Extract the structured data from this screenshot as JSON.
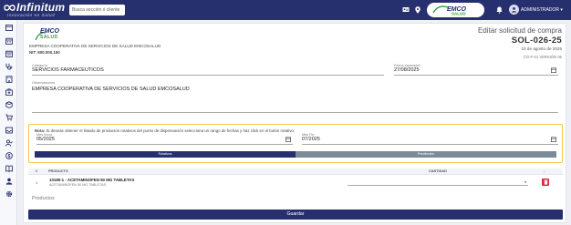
{
  "header": {
    "logo_text": "Infinitum",
    "logo_sub": "Innovación en Salud",
    "search_placeholder": "Busca sección ó cliente",
    "user_label": "ADMINISTRADOR",
    "icons": [
      "id-card-icon",
      "location-pin-icon",
      "bell-icon",
      "user-avatar-icon",
      "chevron-down-icon"
    ]
  },
  "sidebar": {
    "icons": [
      "menu-icon",
      "calendar-icon",
      "calendar-alt-icon",
      "stethoscope-icon",
      "building-icon",
      "medkit-icon",
      "box-icon",
      "cart-icon",
      "inbox-icon",
      "user-check-icon",
      "dollar-icon",
      "book-icon",
      "user-icon",
      "gear-icon"
    ]
  },
  "company": {
    "logo_emco": "EMCO",
    "logo_salud": "SALUD",
    "name": "EMPRESA COOPERATIVA DE SERVICIOS DE SALUD EMCOSALUD",
    "nit": "NIT: 800.000.150"
  },
  "document": {
    "title": "Editar solicitud de compra",
    "code": "SOL-026-25",
    "date": "22 de agosto de 2025",
    "version": "CO-F-01 VERSIÓN 06"
  },
  "form": {
    "categoria_label": "Categoría",
    "categoria_value": "SERVICIOS FARMACEUTICOS",
    "fecha_label": "Fecha esperada*",
    "fecha_value": "27/08/2025",
    "observaciones_label": "Observaciones",
    "observaciones_value": "EMPRESA COOPERATIVA DE SERVICIOS DE SALUD EMCOSALUD"
  },
  "alert": {
    "note_bold": "Nota:",
    "note_text": " Si deseas obtener el listado de productos rotativos del punto de dispensación selecciona un rango de fechas y haz click en el botón rotativo:",
    "mes_inicio_label": "Mes Inicio",
    "mes_inicio_value": "05/2025",
    "mes_fin_label": "Mes Fin",
    "mes_fin_value": "07/2025",
    "toggle_left": "Rotativos",
    "toggle_right": "Pendientes"
  },
  "table": {
    "headers": [
      "#",
      "PRODUCTO",
      "CANTIDAD",
      "-"
    ],
    "rows": [
      {
        "num": "1",
        "product": "10180-1 - ACETAMINOFEN 50 MG TABLETAS",
        "sub": "ACETAMINOFEN 50 MG TABLETAS"
      }
    ]
  },
  "productos_label": "Productos",
  "save_button": "Guardar",
  "colors": {
    "primary": "#27306f",
    "accent": "#2f9a3a",
    "danger": "#d7263d",
    "warning": "#f3c64f"
  }
}
